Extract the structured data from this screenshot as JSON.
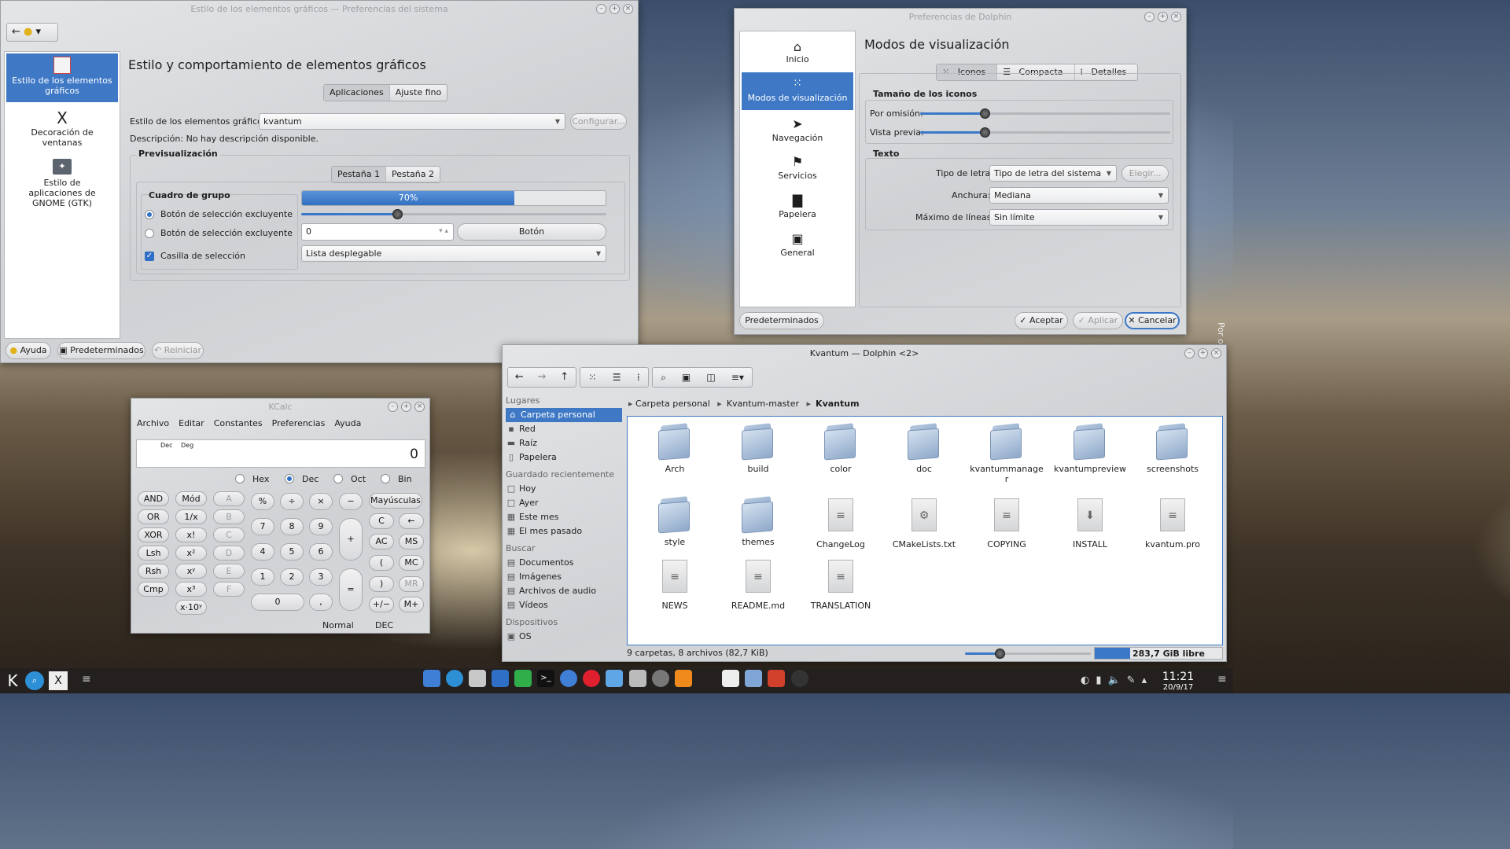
{
  "settings": {
    "title": "Estilo de los elementos gráficos — Preferencias del sistema",
    "sidebar": [
      "Estilo de los elementos gráficos",
      "Decoración de ventanas",
      "Estilo de aplicaciones de GNOME (GTK)"
    ],
    "heading": "Estilo y comportamiento de elementos gráficos",
    "tabs": [
      "Aplicaciones",
      "Ajuste fino"
    ],
    "style_label": "Estilo de los elementos gráficos:",
    "style_value": "kvantum",
    "configure": "Configurar...",
    "description": "Descripción: No hay descripción disponible.",
    "preview": "Previsualización",
    "ptabs": [
      "Pestaña 1",
      "Pestaña 2"
    ],
    "group": "Cuadro de grupo",
    "radio1": "Botón de selección excluyente",
    "radio2": "Botón de selección excluyente",
    "check": "Casilla de selección",
    "progress": "70%",
    "progress_value": 0.7,
    "spin": "0",
    "button": "Botón",
    "combo": "Lista desplegable",
    "help": "Ayuda",
    "defaults": "Predeterminados",
    "reset": "Reiniciar"
  },
  "dolphin_prefs": {
    "title": "Preferencias de Dolphin",
    "nav": [
      "Inicio",
      "Modos de visualización",
      "Navegación",
      "Servicios",
      "Papelera",
      "General"
    ],
    "heading": "Modos de visualización",
    "tabs": [
      "Iconos",
      "Compacta",
      "Detalles"
    ],
    "icon_size": "Tamaño de los iconos",
    "default_lbl": "Por omisión:",
    "preview_lbl": "Vista previa:",
    "default_value": 0.35,
    "preview_value": 0.35,
    "text": "Texto",
    "font_lbl": "Tipo de letra:",
    "font_val": "Tipo de letra del sistema",
    "choose": "Elegir...",
    "width_lbl": "Anchura:",
    "width_val": "Mediana",
    "lines_lbl": "Máximo de líneas:",
    "lines_val": "Sin límite",
    "defaults": "Predeterminados",
    "ok": "Aceptar",
    "apply": "Aplicar",
    "cancel": "Cancelar"
  },
  "kcalc": {
    "title": "KCalc",
    "menu": [
      "Archivo",
      "Editar",
      "Constantes",
      "Preferencias",
      "Ayuda"
    ],
    "dec": "Dec",
    "deg": "Deg",
    "display": "0",
    "bases": [
      "Hex",
      "Dec",
      "Oct",
      "Bin"
    ],
    "left": [
      "AND",
      "OR",
      "XOR",
      "Lsh",
      "Rsh",
      "Cmp"
    ],
    "mid": [
      "Mód",
      "1/x",
      "x!",
      "x²",
      "xʸ",
      "x³",
      "x·10ʸ"
    ],
    "hex": [
      "A",
      "B",
      "C",
      "D",
      "E",
      "F"
    ],
    "ops": [
      "%",
      "÷",
      "×",
      "−"
    ],
    "nums": [
      "7",
      "8",
      "9",
      "4",
      "5",
      "6",
      "1",
      "2",
      "3",
      "0",
      ","
    ],
    "plus": "+",
    "eq": "=",
    "caps": "Mayúsculas",
    "right": [
      "C",
      "←",
      "AC",
      "MS",
      "(",
      "MC",
      ")",
      "MR",
      "+/−",
      "M+"
    ],
    "status": [
      "Normal",
      "DEC"
    ]
  },
  "dolphin": {
    "title": "Kvantum — Dolphin <2>",
    "places_h": "Lugares",
    "places": [
      "Carpeta personal",
      "Red",
      "Raíz",
      "Papelera"
    ],
    "recent_h": "Guardado recientemente",
    "recent": [
      "Hoy",
      "Ayer",
      "Este mes",
      "El mes pasado"
    ],
    "search_h": "Buscar",
    "search": [
      "Documentos",
      "Imágenes",
      "Archivos de audio",
      "Vídeos"
    ],
    "devices_h": "Dispositivos",
    "devices": [
      "OS"
    ],
    "crumbs": [
      "Carpeta personal",
      "Kvantum-master",
      "Kvantum"
    ],
    "folders": [
      "Arch",
      "build",
      "color",
      "doc",
      "kvantummanager",
      "kvantumpreview",
      "screenshots",
      "style",
      "themes"
    ],
    "files": [
      "ChangeLog",
      "CMakeLists.txt",
      "COPYING",
      "INSTALL",
      "kvantum.pro",
      "NEWS",
      "README.md",
      "TRANSLATION"
    ],
    "status": "9 carpetas, 8 archivos (82,7 KiB)",
    "free": "283,7 GiB libre"
  },
  "taskbar": {
    "time": "11:21",
    "date": "20/9/17"
  },
  "side_text": "Por om"
}
